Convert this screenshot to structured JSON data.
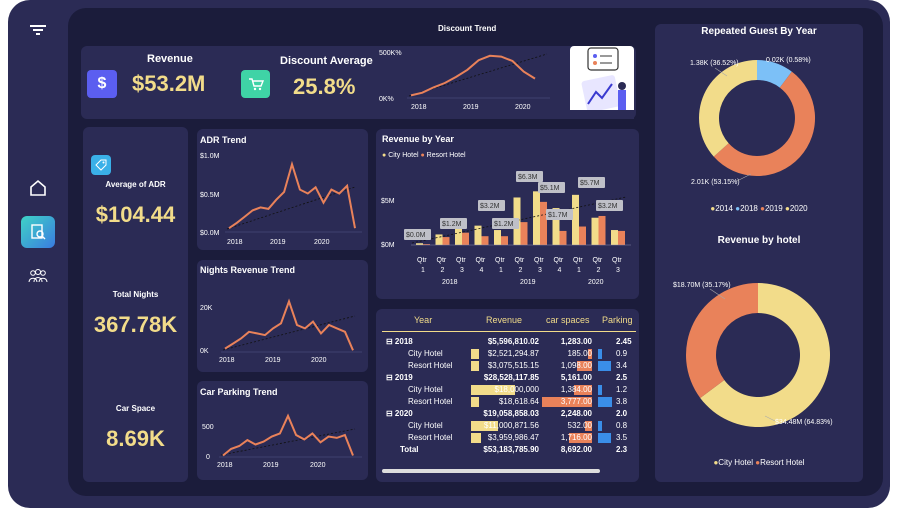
{
  "sidebar": {
    "items": [
      "home-icon",
      "report-icon",
      "people-icon"
    ]
  },
  "kpi": {
    "revenue_label": "Revenue",
    "revenue_value": "$53.2M",
    "discount_label": "Discount Average",
    "discount_value": "25.8%",
    "adr_label": "Average of ADR",
    "adr_value": "$104.44",
    "nights_label": "Total Nights",
    "nights_value": "367.78K",
    "car_label": "Car Space",
    "car_value": "8.69K"
  },
  "colors": {
    "accent_gold": "#f2dc8a",
    "accent_orange": "#e9825a",
    "accent_blue": "#7cc0f7",
    "card": "#2b2b55",
    "bg": "#1b1c3b"
  },
  "discount_trend": {
    "title": "Discount Trend",
    "y_ticks": [
      "500K%",
      "0K%"
    ],
    "x_ticks": [
      "2018",
      "2019",
      "2020"
    ],
    "values": [
      30,
      60,
      120,
      170,
      240,
      320,
      430,
      480,
      470,
      420,
      300,
      220
    ]
  },
  "adr_trend": {
    "title": "ADR Trend",
    "y_ticks": [
      "$1.0M",
      "$0.5M",
      "$0.0M"
    ],
    "x_ticks": [
      "2018",
      "2019",
      "2020"
    ],
    "values": [
      0.05,
      0.12,
      0.2,
      0.28,
      0.32,
      0.3,
      0.42,
      0.52,
      0.88,
      0.55,
      0.5,
      0.58,
      0.38,
      0.55,
      0.5,
      0.6,
      0.05
    ]
  },
  "nights_trend": {
    "title": "Nights Revenue Trend",
    "y_ticks": [
      "20K",
      "0K"
    ],
    "x_ticks": [
      "2018",
      "2019",
      "2020"
    ],
    "values": [
      2,
      5,
      8,
      12,
      11,
      10,
      14,
      17,
      30,
      16,
      14,
      18,
      11,
      16,
      14,
      12,
      1
    ]
  },
  "parking_trend": {
    "title": "Car Parking Trend",
    "y_ticks": [
      "500",
      "0"
    ],
    "x_ticks": [
      "2018",
      "2019",
      "2020"
    ],
    "values": [
      20,
      110,
      150,
      230,
      170,
      210,
      280,
      320,
      560,
      300,
      240,
      320,
      200,
      280,
      260,
      300,
      20
    ]
  },
  "revenue_by_year": {
    "title": "Revenue by Year",
    "legend": [
      "City Hotel",
      "Resort Hotel"
    ],
    "y_ticks": [
      "$5M",
      "$0M"
    ],
    "quarters": [
      "Qtr 1",
      "Qtr 2",
      "Qtr 3",
      "Qtr 4",
      "Qtr 1",
      "Qtr 2",
      "Qtr 3",
      "Qtr 4",
      "Qtr 1",
      "Qtr 2",
      "Qtr 3"
    ],
    "years": [
      "2018",
      "2019",
      "2020"
    ],
    "labels": [
      "$0.0M",
      "$1.2M",
      "$3.2M",
      "$1.2M",
      "$6.3M",
      "$5.1M",
      "$1.7M",
      "$5.7M",
      "$3.2M"
    ]
  },
  "repeated_guest": {
    "title": "Repeated Guest By Year",
    "labels": [
      "1.38K (36.52%)",
      "0.02K (0.58%)",
      "2.01K (53.15%)"
    ],
    "legend": [
      "2014",
      "2018",
      "2019",
      "2020"
    ]
  },
  "revenue_by_hotel": {
    "title": "Revenue by hotel",
    "labels": [
      "$18.70M (35.17%)",
      "$34.48M (64.83%)"
    ],
    "legend": [
      "City Hotel",
      "Resort Hotel"
    ]
  },
  "matrix": {
    "headers": [
      "Year",
      "Revenue",
      "car spaces",
      "Parking"
    ],
    "rows": [
      {
        "label": "2018",
        "revenue": "$5,596,810.02",
        "cars": "1,283.00",
        "parking": "2.45",
        "level": 0
      },
      {
        "label": "City Hotel",
        "revenue": "$2,521,294.87",
        "cars": "185.00",
        "parking": "0.9",
        "level": 1
      },
      {
        "label": "Resort Hotel",
        "revenue": "$3,075,515.15",
        "cars": "1,098.00",
        "parking": "3.4",
        "level": 1
      },
      {
        "label": "2019",
        "revenue": "$28,528,117.85",
        "cars": "5,161.00",
        "parking": "2.5",
        "level": 0
      },
      {
        "label": "City Hotel",
        "revenue": "$18,000,000",
        "cars": "1,384.00",
        "parking": "1.2",
        "level": 1
      },
      {
        "label": "Resort Hotel",
        "revenue": "$18,618.64",
        "cars": "3,777.00",
        "parking": "3.8",
        "level": 1
      },
      {
        "label": "2020",
        "revenue": "$19,058,858.03",
        "cars": "2,248.00",
        "parking": "2.0",
        "level": 0
      },
      {
        "label": "City Hotel",
        "revenue": "$11,000,871.56",
        "cars": "532.00",
        "parking": "0.8",
        "level": 1
      },
      {
        "label": "Resort Hotel",
        "revenue": "$3,959,986.47",
        "cars": "1,716.00",
        "parking": "3.5",
        "level": 1
      }
    ],
    "total": {
      "label": "Total",
      "revenue": "$53,183,785.90",
      "cars": "8,692.00",
      "parking": "2.3"
    }
  }
}
